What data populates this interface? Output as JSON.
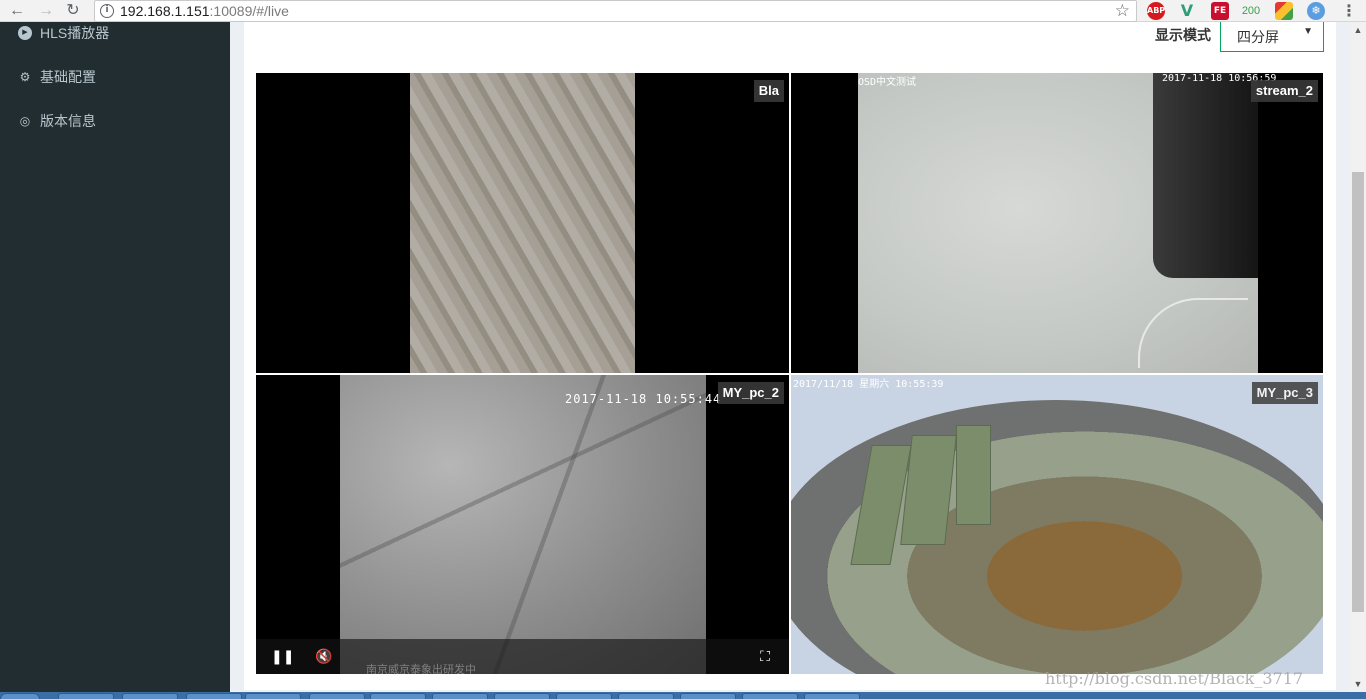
{
  "browser": {
    "back_icon": "arrow-left-icon",
    "forward_icon": "arrow-right-icon",
    "reload_icon": "reload-icon",
    "url_host": "192.168.1.151",
    "url_rest": ":10089/#/live",
    "extensions": {
      "abp": "ABP",
      "fe": "FE",
      "counter": "200"
    }
  },
  "sidebar": {
    "items": [
      {
        "label": "HLS播放器",
        "icon": "play-circle-icon"
      },
      {
        "label": "基础配置",
        "icon": "cogs-icon"
      },
      {
        "label": "版本信息",
        "icon": "life-ring-icon"
      }
    ]
  },
  "toolbar": {
    "display_mode_label": "显示模式",
    "display_mode_value": "四分屏"
  },
  "tiles": [
    {
      "badge": "Bla"
    },
    {
      "badge": "stream_2",
      "osd_left": "OSD中文测试",
      "osd_time": "2017-11-18 10:56:59"
    },
    {
      "badge": "MY_pc_2",
      "osd_time": "2017-11-18 10:55:44",
      "caption": "南京威京泰象出研发中"
    },
    {
      "badge": "MY_pc_3",
      "osd_time": "2017/11/18 星期六 10:55:39"
    }
  ],
  "watermark": "http://blog.csdn.net/Black_3717"
}
